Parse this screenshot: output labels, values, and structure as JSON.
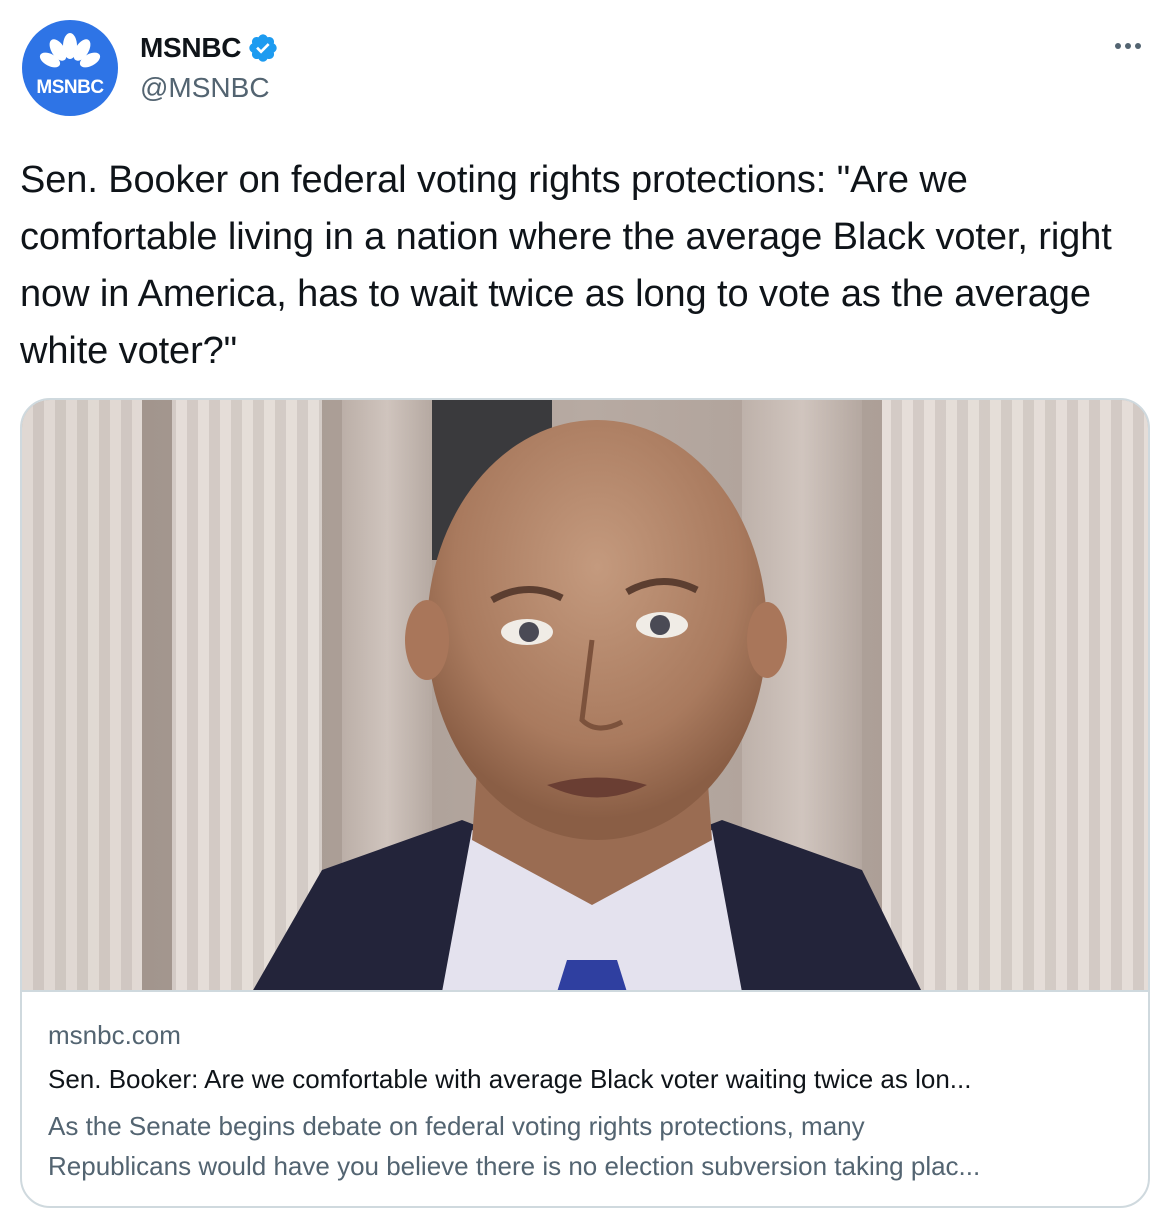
{
  "author": {
    "display_name": "MSNBC",
    "handle": "@MSNBC",
    "verified": true,
    "avatar_text": "MSNBC",
    "avatar_icon": "peacock-logo"
  },
  "more_menu": {
    "icon": "more-horizontal-icon"
  },
  "tweet": {
    "text": "Sen. Booker on federal voting rights protections: \"Are we comfortable living in a nation where the average Black voter, right now in America, has to wait twice as long to vote as the average white voter?\""
  },
  "link_card": {
    "domain": "msnbc.com",
    "title": "Sen. Booker: Are we comfortable with average Black voter waiting twice as lon...",
    "description_line1": "As the Senate begins debate on federal voting rights protections, many",
    "description_line2": "Republicans would have you believe there is no election subversion taking plac..."
  },
  "colors": {
    "text_primary": "#0f1419",
    "text_secondary": "#536471",
    "border": "#cfd9de",
    "verified_blue": "#1d9bf0",
    "msnbc_blue": "#2e74e6"
  }
}
